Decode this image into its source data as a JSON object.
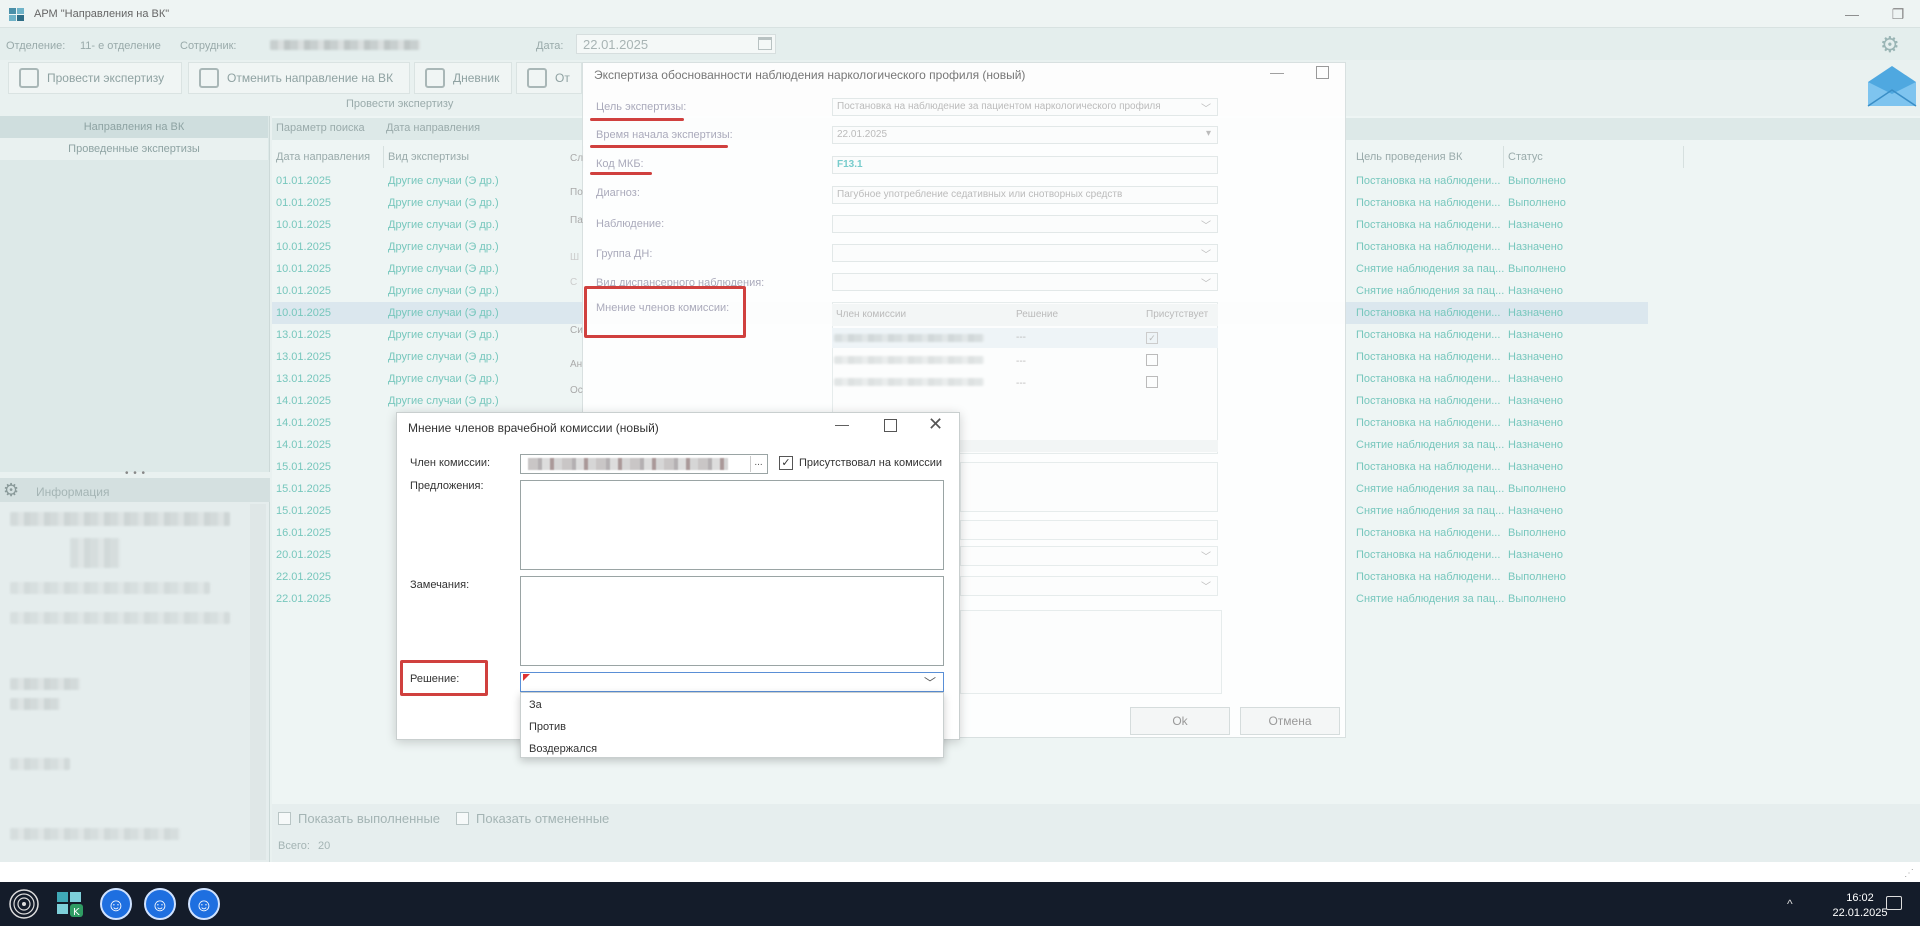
{
  "window": {
    "title": "АРМ \"Направления на ВК\"",
    "minimize": "—",
    "restore": "❐"
  },
  "infobar": {
    "department_label": "Отделение:",
    "department_value": "11- е отделение",
    "employee_label": "Сотрудник:",
    "date_label": "Дата:",
    "date_value": "22.01.2025"
  },
  "toolbar": {
    "run_exam": "Провести экспертизу",
    "cancel_referral": "Отменить направление на ВК",
    "diary": "Дневник",
    "other_cut": "От",
    "caption": "Провести экспертизу"
  },
  "leftnav": {
    "items": [
      "Направления на ВК",
      "Проведенные экспертизы"
    ],
    "splitter": "• • •"
  },
  "info_panel": {
    "title": "Информация"
  },
  "grid": {
    "search_param": "Параметр поиска",
    "search_date": "Дата направления",
    "columns": [
      "Дата направления",
      "Вид экспертизы",
      "Цель проведения ВК",
      "Статус"
    ],
    "rows": [
      {
        "date": "01.01.2025",
        "type": "Другие случаи (Э др.)",
        "goal": "Постановка на наблюдени...",
        "status": "Выполнено"
      },
      {
        "date": "01.01.2025",
        "type": "Другие случаи (Э др.)",
        "goal": "Постановка на наблюдени...",
        "status": "Выполнено"
      },
      {
        "date": "10.01.2025",
        "type": "Другие случаи (Э др.)",
        "goal": "Постановка на наблюдени...",
        "status": "Назначено"
      },
      {
        "date": "10.01.2025",
        "type": "Другие случаи (Э др.)",
        "goal": "Постановка на наблюдени...",
        "status": "Назначено"
      },
      {
        "date": "10.01.2025",
        "type": "Другие случаи (Э др.)",
        "goal": "Снятие наблюдения за пац...",
        "status": "Выполнено"
      },
      {
        "date": "10.01.2025",
        "type": "Другие случаи (Э др.)",
        "goal": "Снятие наблюдения за пац...",
        "status": "Назначено"
      },
      {
        "date": "10.01.2025",
        "type": "Другие случаи (Э др.)",
        "goal": "Постановка на наблюдени...",
        "status": "Назначено"
      },
      {
        "date": "13.01.2025",
        "type": "Другие случаи (Э др.)",
        "goal": "Постановка на наблюдени...",
        "status": "Назначено"
      },
      {
        "date": "13.01.2025",
        "type": "Другие случаи (Э др.)",
        "goal": "Постановка на наблюдени...",
        "status": "Назначено"
      },
      {
        "date": "13.01.2025",
        "type": "Другие случаи (Э др.)",
        "goal": "Постановка на наблюдени...",
        "status": "Назначено"
      },
      {
        "date": "14.01.2025",
        "type": "Другие случаи (Э др.)",
        "goal": "Постановка на наблюдени...",
        "status": "Назначено"
      },
      {
        "date": "14.01.2025",
        "type": "",
        "goal": "Постановка на наблюдени...",
        "status": "Назначено"
      },
      {
        "date": "14.01.2025",
        "type": "",
        "goal": "Снятие наблюдения за пац...",
        "status": "Назначено"
      },
      {
        "date": "15.01.2025",
        "type": "",
        "goal": "Постановка на наблюдени...",
        "status": "Назначено"
      },
      {
        "date": "15.01.2025",
        "type": "",
        "goal": "Снятие наблюдения за пац...",
        "status": "Выполнено"
      },
      {
        "date": "15.01.2025",
        "type": "",
        "goal": "Снятие наблюдения за пац...",
        "status": "Назначено"
      },
      {
        "date": "16.01.2025",
        "type": "",
        "goal": "Постановка на наблюдени...",
        "status": "Выполнено"
      },
      {
        "date": "20.01.2025",
        "type": "",
        "goal": "Постановка на наблюдени...",
        "status": "Назначено"
      },
      {
        "date": "22.01.2025",
        "type": "",
        "goal": "Постановка на наблюдени...",
        "status": "Выполнено"
      },
      {
        "date": "22.01.2025",
        "type": "",
        "goal": "Снятие наблюдения за пац...",
        "status": "Выполнено"
      }
    ],
    "selected_row_index": 6,
    "show_done": "Показать выполненные",
    "show_cancelled": "Показать отмененные",
    "total_label": "Всего:",
    "total_value": "20"
  },
  "dialog_exam": {
    "title": "Экспертиза обоснованности наблюдения наркологического профиля (новый)",
    "labels": [
      "Цель экспертизы:",
      "Время начала экспертизы:",
      "Код МКБ:",
      "Диагноз:",
      "Наблюдение:",
      "Группа ДН:",
      "Вид диспансерного наблюдения:",
      "Мнение членов комиссии:"
    ],
    "goal_value": "Постановка на наблюдение за пациентом наркологического профиля",
    "time_value": "22.01.2025",
    "mkb_value": "F13.1",
    "diagnosis_value": "Пагубное употребление седативных или снотворных средств",
    "members_headers": [
      "Член комиссии",
      "Решение",
      "Присутствует"
    ],
    "members_rows": [
      {
        "decision": "---",
        "present": true
      },
      {
        "decision": "---",
        "present": false
      },
      {
        "decision": "---",
        "present": false
      }
    ],
    "behind_labels": [
      "Сл",
      "По",
      "Па",
      "Ш",
      "С",
      "Си",
      "Ан",
      "Ос"
    ],
    "ok": "Ok",
    "cancel": "Отмена"
  },
  "dialog_member": {
    "title": "Мнение членов врачебной комиссии (новый)",
    "member_label": "Член комиссии:",
    "member_dots": "...",
    "present_label": "Присутствовал на комиссии",
    "present_checked": true,
    "proposals_label": "Предложения:",
    "remarks_label": "Замечания:",
    "decision_label": "Решение:",
    "decision_options": [
      "За",
      "Против",
      "Воздержался"
    ]
  },
  "taskbar": {
    "time": "16:02",
    "date": "22.01.2025",
    "tray_chevron": "^"
  },
  "colors": {
    "accent_teal": "#77c7bd",
    "annotation_red": "#d0403e",
    "taskbar": "#141c2a"
  }
}
